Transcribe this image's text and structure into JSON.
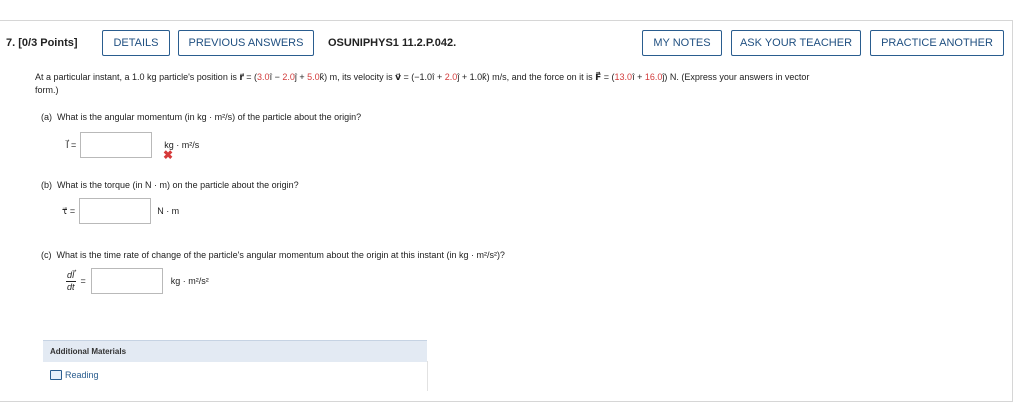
{
  "header": {
    "question_number": "7. [0/3 Points]",
    "buttons": {
      "details": "DETAILS",
      "previous_answers": "PREVIOUS ANSWERS",
      "my_notes": "MY NOTES",
      "ask_teacher": "ASK YOUR TEACHER",
      "practice_another": "PRACTICE ANOTHER"
    },
    "question_id": "OSUNIPHYS1 11.2.P.042."
  },
  "problem": {
    "p1": "At a particular instant, a 1.0 kg particle's position is ",
    "r_sym": "r⃗",
    "p2": " = (",
    "r_i": "3.0",
    "p3": "î − ",
    "r_j": "2.0",
    "p4": "ĵ + ",
    "r_k": "5.0",
    "p5": "k̂) m, its velocity is ",
    "v_sym": "v⃗",
    "p6": " = (−1.0î + ",
    "v_j": "2.0",
    "p7": "ĵ + 1.0k̂) m/s, and the force on it is ",
    "f_sym": "F⃗",
    "p8": " = (",
    "f_i": "13.0",
    "p9": "î + ",
    "f_j": "16.0",
    "p10": "ĵ) N. (Express your answers in vector",
    "p11": "form.)"
  },
  "parts": {
    "a": {
      "label": "(a)",
      "question": "What is the angular momentum (in kg · m²/s) of the particle about the origin?",
      "symbol": "l⃗ =",
      "unit": "kg · m²/s",
      "value": ""
    },
    "b": {
      "label": "(b)",
      "question": "What is the torque (in N · m) on the particle about the origin?",
      "symbol": "τ⃗ =",
      "unit": "N · m",
      "value": ""
    },
    "c": {
      "label": "(c)",
      "question": "What is the time rate of change of the particle's angular momentum about the origin at this instant (in kg · m²/s²)?",
      "numerator": "dl⃗",
      "denominator": "dt",
      "equals": "=",
      "unit": "kg · m²/s²",
      "value": ""
    }
  },
  "additional_materials": {
    "title": "Additional Materials",
    "reading": "Reading"
  },
  "colors": {
    "button_border": "#2a5d8f",
    "button_text": "#1f4f80",
    "red_values": "#d23c3c",
    "materials_bg": "#e3eaf3"
  },
  "icons": {
    "wrong_mark": "✖"
  }
}
